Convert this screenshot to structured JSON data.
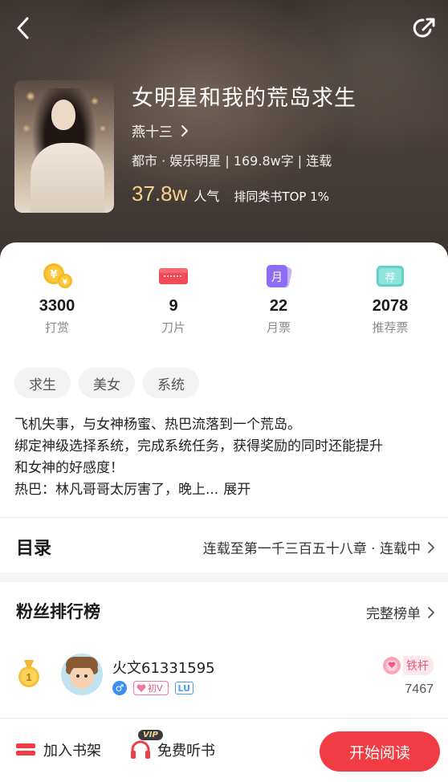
{
  "header": {
    "back_icon": "chevron-left-icon",
    "share_icon": "share-icon"
  },
  "book": {
    "title": "女明星和我的荒岛求生",
    "author": "燕十三",
    "meta": "都市 · 娱乐明星 | 169.8w字 | 连载",
    "popularity_value": "37.8w",
    "popularity_label": "人气",
    "rank_text": "排同类书TOP 1%"
  },
  "stats": [
    {
      "icon": "coin-icon",
      "value": "3300",
      "label": "打赏"
    },
    {
      "icon": "blade-icon",
      "value": "9",
      "label": "刀片"
    },
    {
      "icon": "monthly-ticket-icon",
      "value": "22",
      "label": "月票"
    },
    {
      "icon": "recommend-ticket-icon",
      "value": "2078",
      "label": "推荐票",
      "icon_text": "荐"
    }
  ],
  "monthly_icon_text": "月",
  "tags": [
    "求生",
    "美女",
    "系统"
  ],
  "description": {
    "line1": "飞机失事，与女神杨蜜、热巴流落到一个荒岛。",
    "line2": "绑定神级选择系统，完成系统任务，获得奖励的同时还能提升",
    "line3": "和女神的好感度！",
    "line4": "热巴：林凡哥哥太厉害了，晚上...",
    "expand_label": "展开"
  },
  "toc": {
    "title": "目录",
    "status": "连载至第一千三百五十八章 · 连载中"
  },
  "fans": {
    "title": "粉丝排行榜",
    "more_label": "完整榜单",
    "entries": [
      {
        "rank": "1",
        "name": "火文61331595",
        "gender_icon": "male-icon",
        "male_symbol": "♂",
        "vip_label": "初V",
        "level_label": "LU",
        "title_badge": "铁杆",
        "score": "7467"
      }
    ]
  },
  "bottom": {
    "shelf_label": "加入书架",
    "listen_label": "免费听书",
    "vip_label": "VIP",
    "read_label": "开始阅读"
  },
  "colors": {
    "accent": "#f23c44",
    "popularity": "#f5d48a"
  }
}
